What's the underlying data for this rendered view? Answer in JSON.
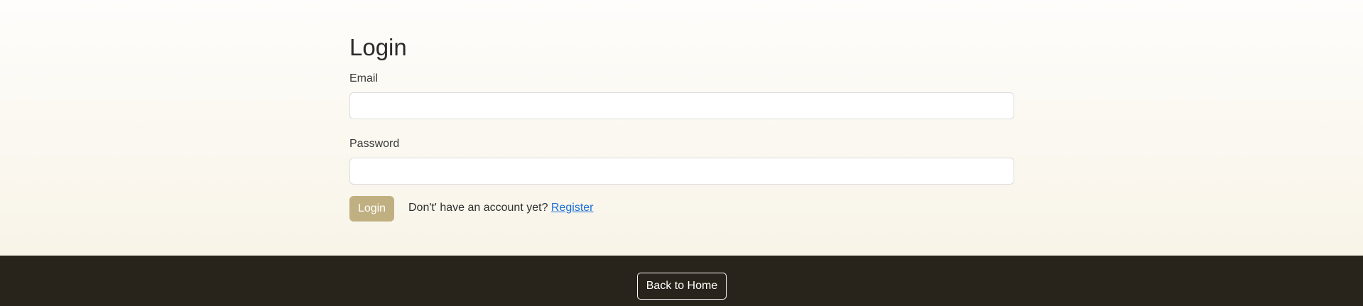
{
  "login_form": {
    "title": "Login",
    "email_label": "Email",
    "email_value": "",
    "password_label": "Password",
    "password_value": "",
    "submit_label": "Login",
    "register_prompt": "Don't' have an account yet?",
    "register_link": "Register"
  },
  "footer": {
    "back_home_label": "Back to Home"
  },
  "colors": {
    "accent": "#c0b081",
    "footer_bg": "#28241b",
    "link": "#1a6fd6",
    "page_bg_top": "#fefdfb",
    "page_bg_bottom": "#f7f2e4"
  }
}
